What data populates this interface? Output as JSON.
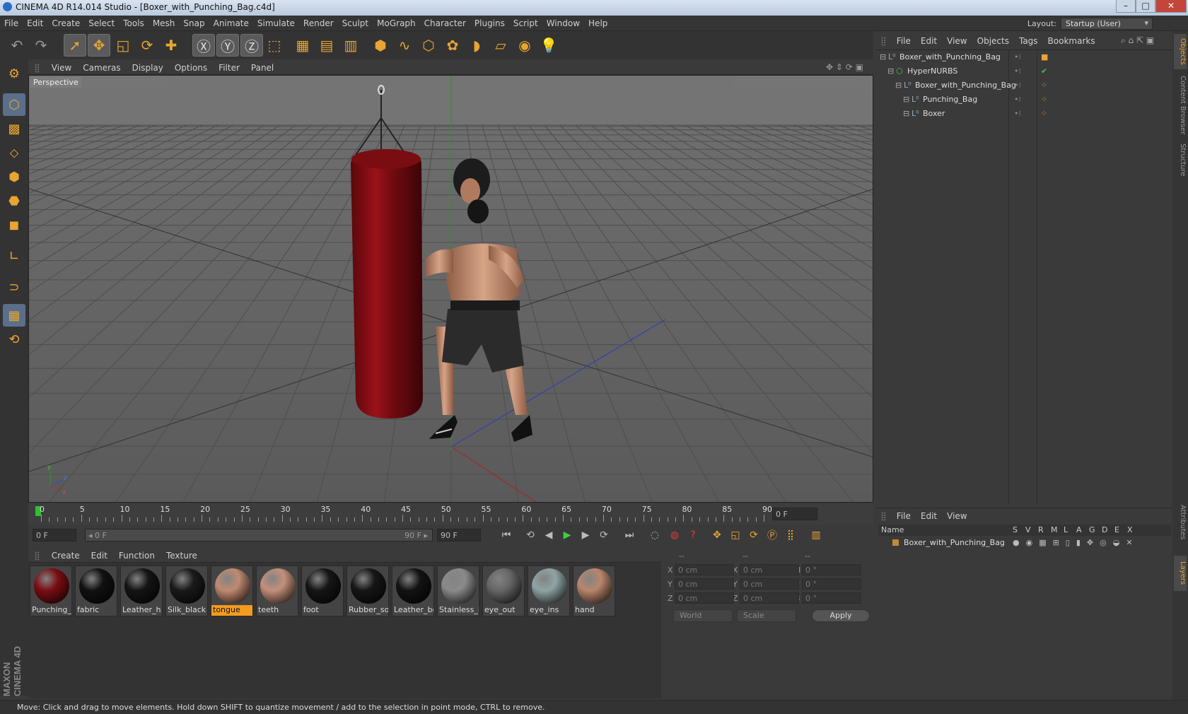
{
  "window": {
    "title": "CINEMA 4D R14.014 Studio - [Boxer_with_Punching_Bag.c4d]",
    "min": "–",
    "max": "□",
    "close": "✕"
  },
  "menu": [
    "File",
    "Edit",
    "Create",
    "Select",
    "Tools",
    "Mesh",
    "Snap",
    "Animate",
    "Simulate",
    "Render",
    "Sculpt",
    "MoGraph",
    "Character",
    "Plugins",
    "Script",
    "Window",
    "Help"
  ],
  "layout": {
    "label": "Layout:",
    "value": "Startup (User)"
  },
  "toolbar_icons": [
    "undo-icon",
    "redo-icon",
    "live-selection-icon",
    "move-icon",
    "scale-icon",
    "rotate-icon",
    "add-icon",
    "x-axis-icon",
    "y-axis-icon",
    "z-axis-icon",
    "coordinate-system-icon",
    "render-view-icon",
    "render-picture-viewer-icon",
    "render-settings-icon",
    "cube-icon",
    "spline-icon",
    "nurbs-icon",
    "array-icon",
    "deformer-icon",
    "floor-icon",
    "camera-icon",
    "light-icon"
  ],
  "viewport": {
    "menu": [
      "View",
      "Cameras",
      "Display",
      "Options",
      "Filter",
      "Panel"
    ],
    "label": "Perspective",
    "axis": {
      "y": "y",
      "z": "z",
      "x": "x"
    }
  },
  "timeline": {
    "ticks": [
      "0",
      "5",
      "10",
      "15",
      "20",
      "25",
      "30",
      "35",
      "40",
      "45",
      "50",
      "55",
      "60",
      "65",
      "70",
      "75",
      "80",
      "85",
      "90"
    ],
    "current_frame": "0 F"
  },
  "transport": {
    "start": "0 F",
    "range_start": "◂ 0 F",
    "range_end": "90 F ▸",
    "end": "90 F"
  },
  "material_manager": {
    "menu": [
      "Create",
      "Edit",
      "Function",
      "Texture"
    ],
    "materials": [
      {
        "name": "Punching_l",
        "color": "#7a0d12"
      },
      {
        "name": "fabric",
        "color": "#111111"
      },
      {
        "name": "Leather_h",
        "color": "#141414"
      },
      {
        "name": "Silk_black",
        "color": "#1a1a1a"
      },
      {
        "name": "tongue",
        "color": "#c08a70",
        "selected": true
      },
      {
        "name": "teeth",
        "color": "#c4907a"
      },
      {
        "name": "foot",
        "color": "#151515"
      },
      {
        "name": "Rubber_so",
        "color": "#161616"
      },
      {
        "name": "Leather_bo",
        "color": "#131313"
      },
      {
        "name": "Stainless_h",
        "color": "#8a8a8a"
      },
      {
        "name": "eye_out",
        "color": "#666666"
      },
      {
        "name": "eye_ins",
        "color": "#8fa4a4"
      },
      {
        "name": "hand",
        "color": "#b8866c"
      }
    ]
  },
  "coordinates": {
    "headers": [
      "--",
      "--",
      "--"
    ],
    "rows": [
      {
        "a": "X",
        "v1": "0 cm",
        "b": "X",
        "v2": "0 cm",
        "c": "H",
        "v3": "0 °"
      },
      {
        "a": "Y",
        "v1": "0 cm",
        "b": "Y",
        "v2": "0 cm",
        "c": "P",
        "v3": "0 °"
      },
      {
        "a": "Z",
        "v1": "0 cm",
        "b": "Z",
        "v2": "0 cm",
        "c": "B",
        "v3": "0 °"
      }
    ],
    "space": "World",
    "mode": "Scale",
    "apply": "Apply"
  },
  "object_manager": {
    "menu": [
      "File",
      "Edit",
      "View",
      "Objects",
      "Tags",
      "Bookmarks"
    ],
    "objects": [
      {
        "name": "Boxer_with_Punching_Bag",
        "level": 0
      },
      {
        "name": "HyperNURBS",
        "level": 1
      },
      {
        "name": "Boxer_with_Punching_Bag",
        "level": 2
      },
      {
        "name": "Punching_Bag",
        "level": 3
      },
      {
        "name": "Boxer",
        "level": 3
      }
    ]
  },
  "layer_manager": {
    "menu": [
      "File",
      "Edit",
      "View"
    ],
    "columns": [
      "Name",
      "S",
      "V",
      "R",
      "M",
      "L",
      "A",
      "G",
      "D",
      "E",
      "X"
    ],
    "layers": [
      {
        "name": "Boxer_with_Punching_Bag",
        "color": "#c08a3a"
      }
    ]
  },
  "side_tabs": [
    "Objects",
    "Content Browser",
    "Structure",
    "Attributes",
    "Layers"
  ],
  "brand": "MAXON CINEMA 4D",
  "status": "Move: Click and drag to move elements. Hold down SHIFT to quantize movement / add to the selection in point mode, CTRL to remove."
}
